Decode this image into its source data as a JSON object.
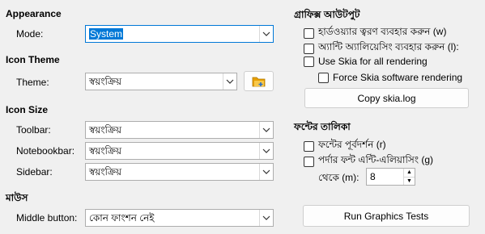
{
  "appearance": {
    "heading": "Appearance",
    "mode_label": "Mode:",
    "mode_value": "System"
  },
  "icon_theme": {
    "heading": "Icon Theme",
    "theme_label": "Theme:",
    "theme_value": "স্বয়ংক্রিয়"
  },
  "icon_size": {
    "heading": "Icon Size",
    "toolbar_label": "Toolbar:",
    "toolbar_value": "স্বয়ংক্রিয়",
    "notebookbar_label": "Notebookbar:",
    "notebookbar_value": "স্বয়ংক্রিয়",
    "sidebar_label": "Sidebar:",
    "sidebar_value": "স্বয়ংক্রিয়"
  },
  "mouse": {
    "heading": "মাউস",
    "middle_button_label": "Middle button:",
    "middle_button_value": "কোন ফাংশন নেই"
  },
  "graphics_output": {
    "heading": "গ্রাফিক্স আউটপুট",
    "hw_accel": "হার্ডওয়্যার ত্বরণ ব্যবহার করুন (w)",
    "antialias": "অ্যান্টি অ্যালিয়েসিং ব্যবহার করুন (l):",
    "use_skia": "Use Skia for all rendering",
    "force_skia": "Force Skia software rendering",
    "copy_skia_button": "Copy skia.log"
  },
  "font_list": {
    "heading": "ফন্টের তালিকা",
    "font_preview": "ফন্টের পূর্বদর্শন (r)",
    "screen_font_aa": "পর্দার ফন্ট এন্টি-এলিয়াসিং (g)",
    "from_label": "থেকে (m):",
    "from_value": "8"
  },
  "run_tests_button": "Run Graphics Tests",
  "colors": {
    "accent": "#0078d7",
    "background": "#f0f0f0",
    "icon_folder": "#e8a000"
  }
}
